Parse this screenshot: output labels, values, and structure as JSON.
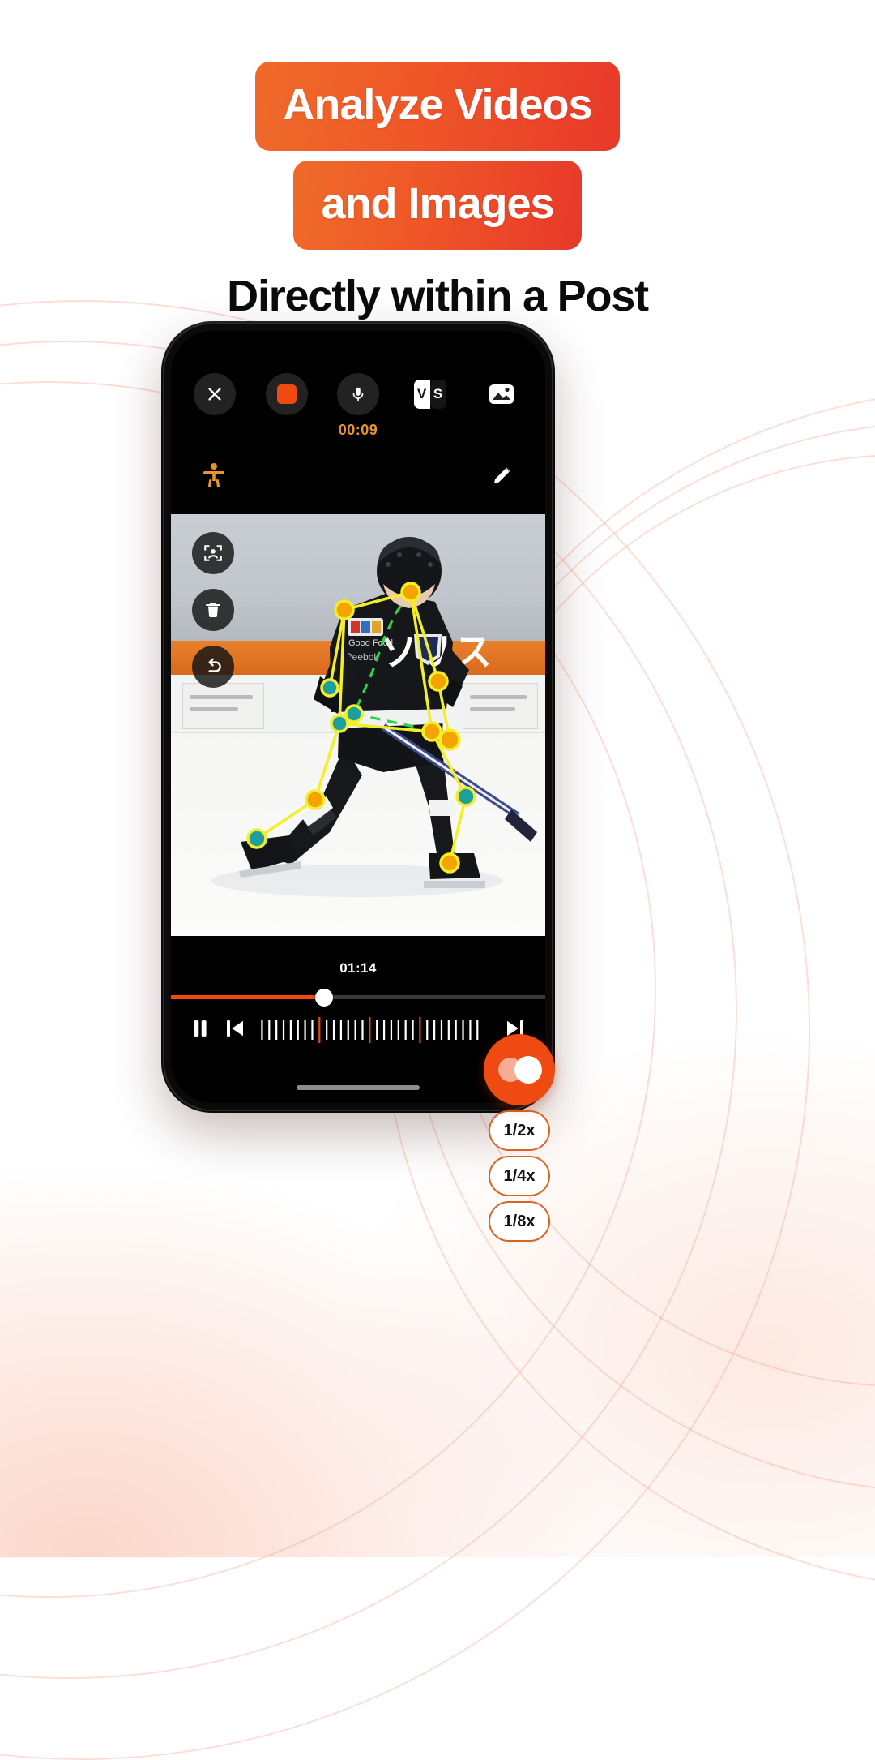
{
  "headline": {
    "badge_line1": "Analyze Videos",
    "badge_line2": "and Images",
    "subline": "Directly within a Post"
  },
  "colors": {
    "accent_orange": "#f04a12",
    "badge_gradient_start": "#ef6b2a",
    "badge_gradient_end": "#e8392a",
    "timer_orange": "#e8932b",
    "pose_orange": "#e8932b",
    "skeleton_line": "#f2ef2a",
    "skeleton_line_green": "#2fd24a",
    "joint_orange": "#f5a300",
    "joint_teal": "#1f9e9e"
  },
  "phone": {
    "toolbar": [
      {
        "name": "close-icon",
        "label": "Close"
      },
      {
        "name": "stop-record-icon",
        "label": "Stop recording"
      },
      {
        "name": "microphone-icon",
        "label": "Microphone"
      },
      {
        "name": "versus-icon",
        "label": "VS",
        "v": "V",
        "s": "S"
      },
      {
        "name": "media-library-icon",
        "label": "Media"
      }
    ],
    "recording_timer": "00:09",
    "tools_row": [
      {
        "name": "pose-figure-icon",
        "label": "Pose tracking"
      },
      {
        "name": "pencil-icon",
        "label": "Draw"
      }
    ],
    "side_tools": [
      {
        "name": "detect-frame-icon",
        "label": "Auto detect"
      },
      {
        "name": "trash-icon",
        "label": "Delete"
      },
      {
        "name": "undo-icon",
        "label": "Undo"
      }
    ],
    "player": {
      "duration": "01:14",
      "progress_percent": 41,
      "controls": [
        {
          "name": "pause-button",
          "label": "Pause"
        },
        {
          "name": "previous-frame-button",
          "label": "Previous frame"
        },
        {
          "name": "frame-scrubber",
          "label": "Frames"
        },
        {
          "name": "next-frame-button",
          "label": "Next frame"
        }
      ]
    }
  },
  "speed_control": {
    "main_label": "Playback speed",
    "options": [
      "1/2x",
      "1/4x",
      "1/8x"
    ]
  }
}
